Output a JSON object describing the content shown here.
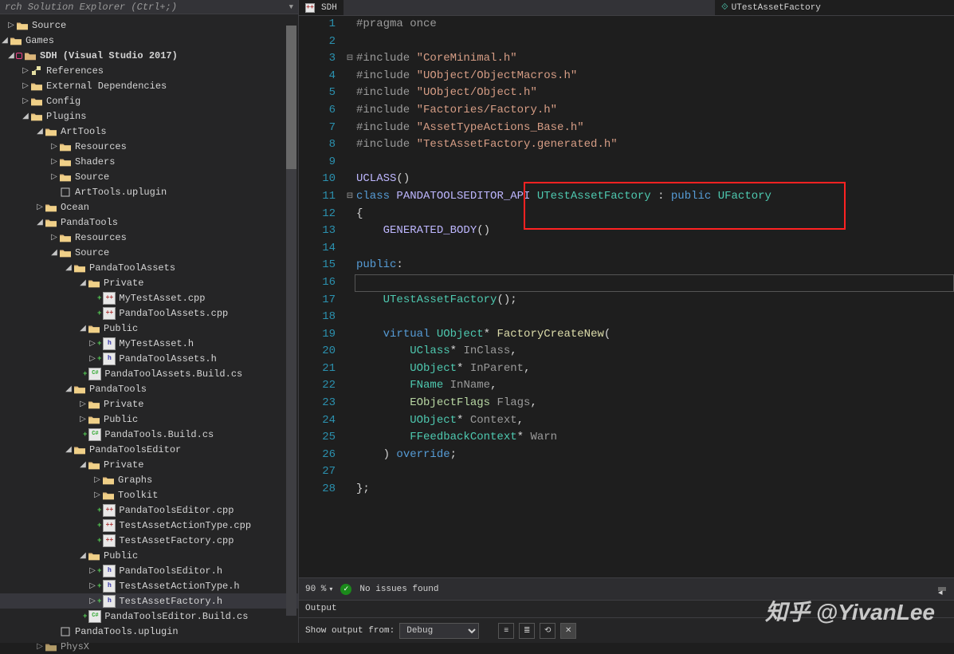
{
  "search": {
    "placeholder": "rch Solution Explorer (Ctrl+;)"
  },
  "tree": {
    "source": "Source",
    "games": "Games",
    "sdh": "SDH (Visual Studio 2017)",
    "references": "References",
    "extdeps": "External Dependencies",
    "config": "Config",
    "plugins": "Plugins",
    "arttools": "ArtTools",
    "resources": "Resources",
    "shaders": "Shaders",
    "arttools_uplugin": "ArtTools.uplugin",
    "ocean": "Ocean",
    "pandatools": "PandaTools",
    "pandatoolassets": "PandaToolAssets",
    "private": "Private",
    "mytestasset_cpp": "MyTestAsset.cpp",
    "pandatoolassets_cpp": "PandaToolAssets.cpp",
    "public": "Public",
    "mytestasset_h": "MyTestAsset.h",
    "pandatoolassets_h": "PandaToolAssets.h",
    "pandatoolassets_build": "PandaToolAssets.Build.cs",
    "pandatoolsdir": "PandaTools",
    "pandatoolsbuild": "PandaTools.Build.cs",
    "pandatoolseditor": "PandaToolsEditor",
    "graphs": "Graphs",
    "toolkit": "Toolkit",
    "pandatoolseditor_cpp": "PandaToolsEditor.cpp",
    "testassetactiontype_cpp": "TestAssetActionType.cpp",
    "testassetfactory_cpp": "TestAssetFactory.cpp",
    "pandatoolseditor_h": "PandaToolsEditor.h",
    "testassetactiontype_h": "TestAssetActionType.h",
    "testassetfactory_h": "TestAssetFactory.h",
    "pandatoolseditor_build": "PandaToolsEditor.Build.cs",
    "pandatoolsuplugin": "PandaTools.uplugin",
    "physx": "PhysX"
  },
  "tabs": {
    "active": "SDH",
    "combo": "UTestAssetFactory"
  },
  "code": {
    "l1": "#pragma once",
    "l3a": "#include ",
    "l3b": "\"CoreMinimal.h\"",
    "l4a": "#include ",
    "l4b": "\"UObject/ObjectMacros.h\"",
    "l5a": "#include ",
    "l5b": "\"UObject/Object.h\"",
    "l6a": "#include ",
    "l6b": "\"Factories/Factory.h\"",
    "l7a": "#include ",
    "l7b": "\"AssetTypeActions_Base.h\"",
    "l8a": "#include ",
    "l8b": "\"TestAssetFactory.generated.h\"",
    "l10": "UCLASS",
    "l10b": "()",
    "l11a": "class ",
    "l11b": "PANDATOOLSEDITOR_API ",
    "l11c": "UTestAssetFactory",
    "l11d": " : ",
    "l11e": "public ",
    "l11f": "UFactory",
    "l12": "{",
    "l13a": "    ",
    "l13b": "GENERATED_BODY",
    "l13c": "()",
    "l15a": "public",
    "l15b": ":",
    "l17a": "    ",
    "l17b": "UTestAssetFactory",
    "l17c": "();",
    "l19a": "    ",
    "l19b": "virtual ",
    "l19c": "UObject",
    "l19d": "* ",
    "l19e": "FactoryCreateNew",
    "l19f": "(",
    "l20a": "        ",
    "l20b": "UClass",
    "l20c": "* ",
    "l20d": "InClass",
    "l20e": ",",
    "l21a": "        ",
    "l21b": "UObject",
    "l21c": "* ",
    "l21d": "InParent",
    "l21e": ",",
    "l22a": "        ",
    "l22b": "FName ",
    "l22c": "InName",
    "l22d": ",",
    "l23a": "        ",
    "l23b": "EObjectFlags ",
    "l23c": "Flags",
    "l23d": ",",
    "l24a": "        ",
    "l24b": "UObject",
    "l24c": "* ",
    "l24d": "Context",
    "l24e": ",",
    "l25a": "        ",
    "l25b": "FFeedbackContext",
    "l25c": "* ",
    "l25d": "Warn",
    "l26a": "    ) ",
    "l26b": "override",
    "l26c": ";",
    "l28": "};"
  },
  "status": {
    "zoom": "90 %",
    "issues": "No issues found"
  },
  "output": {
    "title": "Output",
    "label": "Show output from:",
    "src": "Debug"
  },
  "watermark": "知乎 @YivanLee"
}
